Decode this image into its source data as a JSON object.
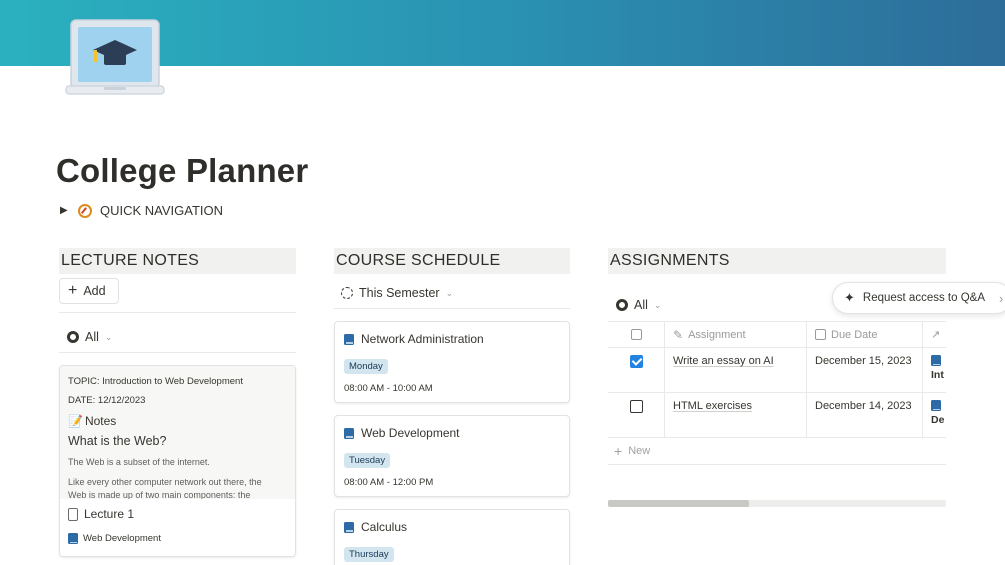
{
  "page": {
    "title": "College Planner",
    "quick_nav_label": "QUICK NAVIGATION"
  },
  "colors": {
    "cover_start": "#2ab1bf",
    "cover_end": "#2d6d9a",
    "accent_blue": "#2383e2",
    "tag_bg": "#d3e5ef"
  },
  "lecture_notes": {
    "header": "LECTURE NOTES",
    "add_label": "Add",
    "view_label": "All",
    "card": {
      "topic": "TOPIC: Introduction to Web Development",
      "date": "DATE: 12/12/2023",
      "notes_heading": "Notes",
      "question": "What is the Web?",
      "para1": "The Web is a subset of the internet.",
      "para2": "Like every other computer network out there, the",
      "para3": "Web is made up of two main components: the",
      "title": "Lecture 1",
      "course_tag": "Web Development"
    }
  },
  "course_schedule": {
    "header": "COURSE SCHEDULE",
    "view_label": "This Semester",
    "courses": [
      {
        "name": "Network Administration",
        "day": "Monday",
        "time": "08:00 AM - 10:00 AM"
      },
      {
        "name": "Web Development",
        "day": "Tuesday",
        "time": "08:00 AM - 12:00 PM"
      },
      {
        "name": "Calculus",
        "day": "Thursday",
        "time": ""
      }
    ]
  },
  "assignments": {
    "header": "ASSIGNMENTS",
    "view_label": "All",
    "columns": {
      "assignment": "Assignment",
      "due_date": "Due Date"
    },
    "rows": [
      {
        "done": true,
        "name": "Write an essay on AI",
        "due": "December 15, 2023",
        "rel1": "Int"
      },
      {
        "done": false,
        "name": "HTML exercises",
        "due": "December 14, 2023",
        "rel1": "De"
      }
    ],
    "new_label": "New",
    "scroll_fraction": 0.42
  },
  "qa_button": {
    "label": "Request access to Q&A"
  }
}
